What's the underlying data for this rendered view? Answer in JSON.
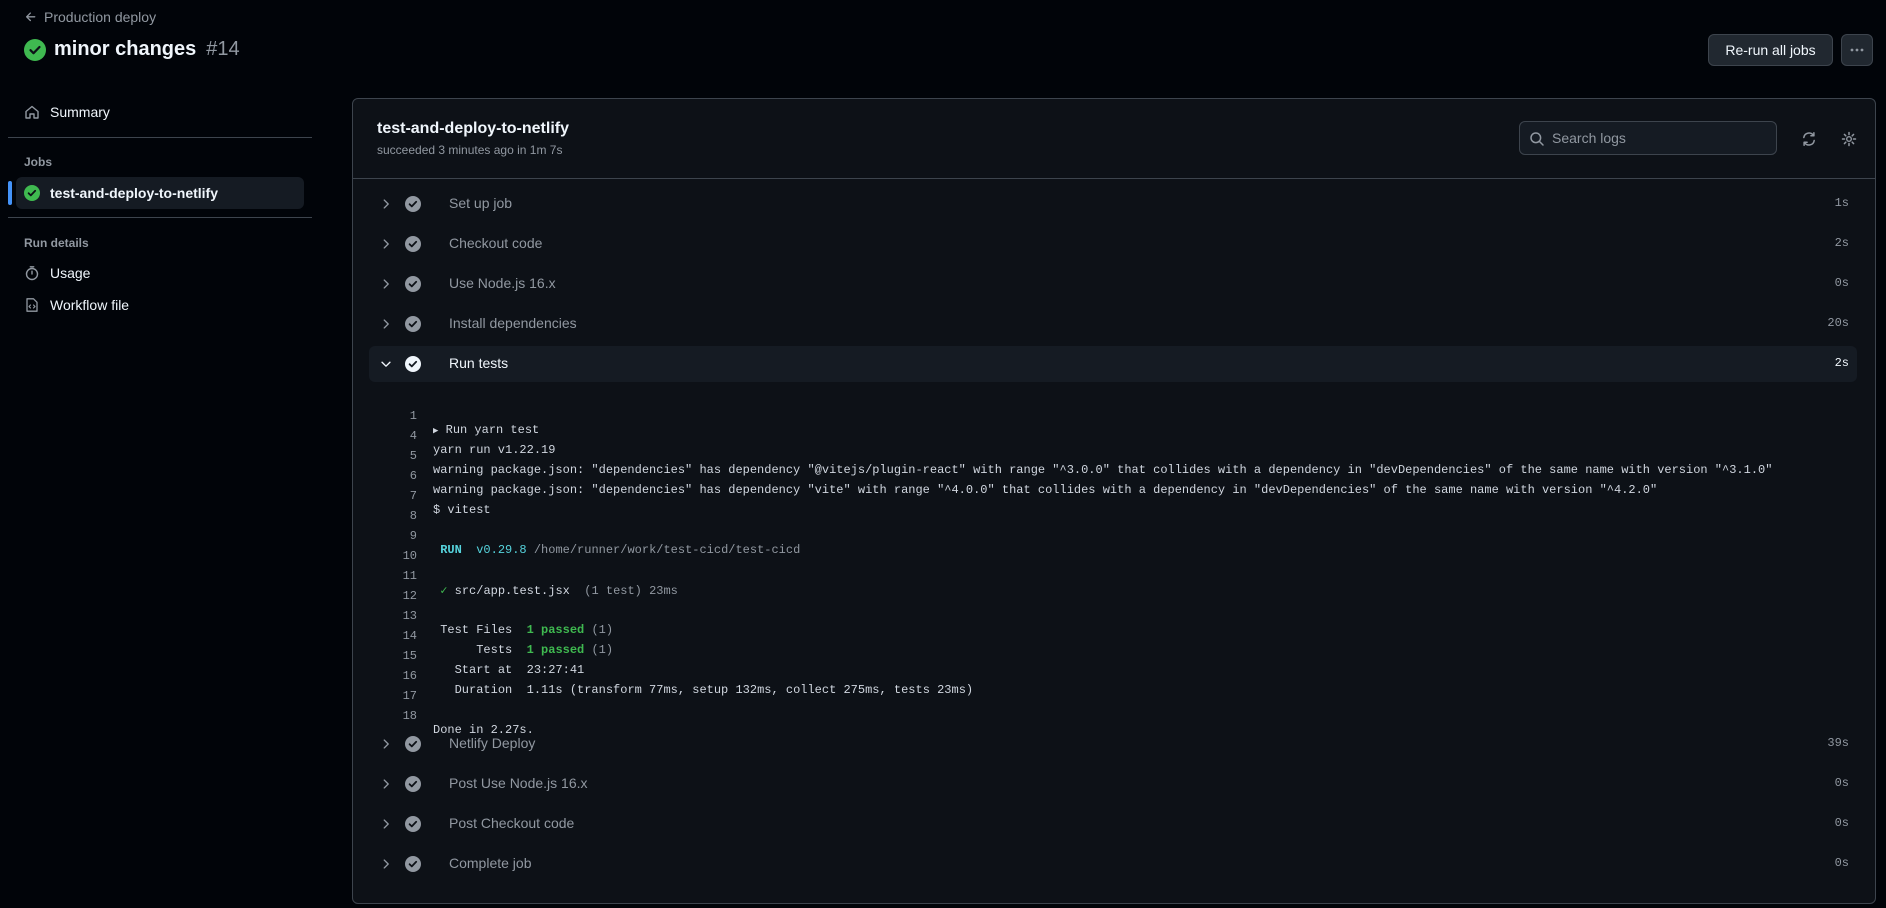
{
  "header": {
    "back_label": "Production deploy",
    "run_title": "minor changes",
    "run_number": "#14",
    "rerun_label": "Re-run all jobs",
    "more_label": "···"
  },
  "sidebar": {
    "summary_label": "Summary",
    "jobs_heading": "Jobs",
    "job_label": "test-and-deploy-to-netlify",
    "run_details_heading": "Run details",
    "usage_label": "Usage",
    "workflow_label": "Workflow file"
  },
  "job": {
    "name": "test-and-deploy-to-netlify",
    "status": "succeeded 3 minutes ago in 1m 7s",
    "search_placeholder": "Search logs"
  },
  "steps": [
    {
      "label": "Set up job",
      "duration": "1s"
    },
    {
      "label": "Checkout code",
      "duration": "2s"
    },
    {
      "label": "Use Node.js 16.x",
      "duration": "0s"
    },
    {
      "label": "Install dependencies",
      "duration": "20s"
    },
    {
      "label": "Run tests",
      "duration": "2s",
      "expanded": true
    },
    {
      "label": "Netlify Deploy",
      "duration": "39s"
    },
    {
      "label": "Post Use Node.js 16.x",
      "duration": "0s"
    },
    {
      "label": "Post Checkout code",
      "duration": "0s"
    },
    {
      "label": "Complete job",
      "duration": "0s"
    }
  ],
  "log": {
    "l1_num": "1",
    "l1_arrow": "▶",
    "l1_text": "Run yarn test",
    "l4_num": "4",
    "l4_text": "yarn run v1.22.19",
    "l5_num": "5",
    "l5_text": "warning package.json: \"dependencies\" has dependency \"@vitejs/plugin-react\" with range \"^3.0.0\" that collides with a dependency in \"devDependencies\" of the same name with version \"^3.1.0\"",
    "l6_num": "6",
    "l6_text": "warning package.json: \"dependencies\" has dependency \"vite\" with range \"^4.0.0\" that collides with a dependency in \"devDependencies\" of the same name with version \"^4.2.0\"",
    "l7_num": "7",
    "l7_text": "$ vitest",
    "l8_num": "8",
    "l9_num": "9",
    "l9_run": "RUN",
    "l9_version": "v0.29.8",
    "l9_path": "/home/runner/work/test-cicd/test-cicd",
    "l10_num": "10",
    "l11_num": "11",
    "l11_check": "✓",
    "l11_file": "src/app.test.jsx",
    "l11_rest": "(1 test) 23ms",
    "l12_num": "12",
    "l13_num": "13",
    "l13_label": "Test Files",
    "l13_passed": "1 passed",
    "l13_count": "(1)",
    "l14_num": "14",
    "l14_label": "Tests",
    "l14_passed": "1 passed",
    "l14_count": "(1)",
    "l15_num": "15",
    "l15_label": "Start at",
    "l15_value": "23:27:41",
    "l16_num": "16",
    "l16_label": "Duration",
    "l16_value": "1.11s (transform 77ms, setup 132ms, collect 275ms, tests 23ms)",
    "l17_num": "17",
    "l18_num": "18",
    "l18_text": "Done in 2.27s."
  },
  "colors": {
    "success": "#3fb950",
    "accent": "#4493f8",
    "background": "#010409",
    "panel": "#0d1117"
  }
}
